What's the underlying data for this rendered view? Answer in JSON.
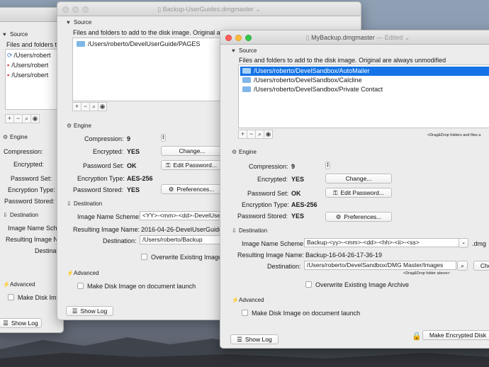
{
  "colors": {
    "accent": "#1473e6",
    "close": "#fc605c",
    "minimize": "#fdbc40",
    "zoom": "#34c84a"
  },
  "back_window": {
    "source_label": "Source",
    "files_label": "Files and folders to",
    "items": [
      "/Users/robert",
      "/Users/robert",
      "/Users/robert"
    ],
    "engine_label": "Engine",
    "compression_label": "Compression:",
    "encrypted_label": "Encrypted:",
    "password_set_label": "Password Set:",
    "encryption_type_label": "Encryption Type:",
    "password_stored_label": "Password  Stored:",
    "destination_label": "Destination",
    "image_name_scheme_label": "Image Name Sche",
    "resulting_image_name_label": "Resulting Image N",
    "destination_field_label": "Destinat",
    "advanced_label": "Advanced",
    "make_disk_image_label": "Make Disk Ima",
    "show_log": "Show Log"
  },
  "middle_window": {
    "title": "Backup-UserGuides.dmgmaster",
    "title_suffix": "⌄",
    "source_label": "Source",
    "files_label": "Files and folders to add to the disk image. Original are always unmodified",
    "items": [
      "/Users/roberto/DevelUserGuide/PAGES"
    ],
    "engine_label": "Engine",
    "compression_label": "Compression:",
    "compression_value": "9",
    "encrypted_label": "Encrypted:",
    "encrypted_value": "YES",
    "change_button": "Change...",
    "password_set_label": "Password Set:",
    "password_set_value": "OK",
    "edit_password_button": "Edit Password...",
    "encryption_type_label": "Encryption Type:",
    "encryption_type_value": "AES-256",
    "password_stored_label": "Password  Stored:",
    "password_stored_value": "YES",
    "preferences_button": "Preferences...",
    "destination_label": "Destination",
    "image_name_scheme_label": "Image Name Scheme:",
    "image_name_scheme_value": "<YY>-<mm>-<dd>-DevelUse",
    "resulting_image_name_label": "Resulting Image Name:",
    "resulting_image_name_value": "2016-04-26-DevelUserGuide",
    "destination_field_label": "Destination:",
    "destination_field_value": "/Users/roberto/Backup",
    "overwrite_label": "Overwrite Existing Image A",
    "advanced_label": "Advanced",
    "make_disk_image_label": "Make Disk Image on document launch",
    "show_log": "Show Log"
  },
  "front_window": {
    "title": "MyBackup.dmgmaster",
    "title_suffix": "— Edited ⌄",
    "source_label": "Source",
    "files_label": "Files and folders to add to the disk image. Original are always unmodified",
    "items": [
      "/Users/roberto/DevelSandbox/AutoMailer",
      "/Users/roberto/DevelSandbox/Calcline",
      "/Users/roberto/DevelSandbox/Private Contact"
    ],
    "drag_hint": "<Drag&Drop folders and files a",
    "engine_label": "Engine",
    "compression_label": "Compression:",
    "compression_value": "9",
    "encrypted_label": "Encrypted:",
    "encrypted_value": "YES",
    "change_button": "Change...",
    "password_set_label": "Password Set:",
    "password_set_value": "OK",
    "edit_password_button": "Edit Password...",
    "encryption_type_label": "Encryption Type:",
    "encryption_type_value": "AES-256",
    "password_stored_label": "Password  Stored:",
    "password_stored_value": "YES",
    "preferences_button": "Preferences...",
    "destination_label": "Destination",
    "image_name_scheme_label": "Image Name Scheme:",
    "image_name_scheme_value": "Backup-<yy>-<mm>-<dd>-<hh>-<ii>-<ss>",
    "dmg_suffix": ".dmg",
    "resulting_image_name_label": "Resulting Image Name:",
    "resulting_image_name_value": "Backup-16-04-26-17-36-19",
    "destination_field_label": "Destination:",
    "destination_field_value": "/Users/roberto/DevelSandbox/DMG Master/Images",
    "choose_button": "Choo",
    "destination_hint": "<Drag&Drop folder above>",
    "overwrite_label": "Overwrite Existing Image Archive",
    "advanced_label": "Advanced",
    "make_disk_image_label": "Make Disk Image on document launch",
    "show_log": "Show Log",
    "make_encrypted_button": "Make Encrypted Disk"
  },
  "icons": {
    "section_source": "heart-icon",
    "section_engine": "gear-icon",
    "section_destination": "download-icon",
    "section_advanced": "bolt-icon",
    "lock": "lock-icon",
    "key": "key-icon",
    "search": "search-icon"
  }
}
